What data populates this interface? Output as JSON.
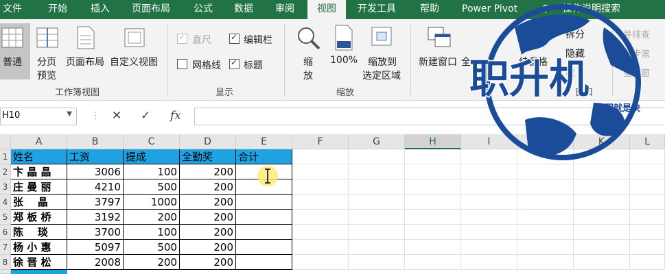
{
  "tabs": [
    "文件",
    "开始",
    "插入",
    "页面布局",
    "公式",
    "数据",
    "审阅",
    "视图",
    "开发工具",
    "帮助",
    "Power Pivot",
    "操作说明搜索"
  ],
  "ribbon": {
    "workbook_views": {
      "normal": "普通",
      "page_break": "分页",
      "page_break2": "预览",
      "page_layout": "页面布局",
      "custom": "自定义视图",
      "group": "工作簿视图"
    },
    "show": {
      "ruler": "直尺",
      "formula_bar": "编辑栏",
      "gridlines": "网格线",
      "headings": "标题",
      "group": "显示"
    },
    "zoom": {
      "zoom1": "缩",
      "zoom2": "放",
      "percent": "100%",
      "zoom_sel1": "缩放到",
      "zoom_sel2": "选定区域",
      "group": "缩放"
    },
    "window": {
      "new_window": "新建窗口",
      "all": "全",
      "freeze": "结窗格",
      "split": "拆分",
      "hide": "隐藏",
      "unhide": "取",
      "group": "窗口",
      "side": "并排查",
      "sync": "同步滚",
      "reset": "重设窗"
    }
  },
  "formula_bar": {
    "name": "H10",
    "cancel": "✕",
    "confirm": "✓",
    "fx": "fx",
    "value": ""
  },
  "columns": [
    "A",
    "B",
    "C",
    "D",
    "E",
    "F",
    "G",
    "H",
    "I",
    "J",
    "K",
    "L"
  ],
  "rows": [
    "1",
    "2",
    "3",
    "4",
    "5",
    "6",
    "7",
    "8"
  ],
  "table": {
    "headers": [
      "姓名",
      "工资",
      "提成",
      "全勤奖",
      "合计"
    ],
    "data": [
      [
        "卞 晶 晶",
        "3006",
        "100",
        "200",
        ""
      ],
      [
        "庄 曼 丽",
        "4210",
        "500",
        "200",
        ""
      ],
      [
        "张    晶",
        "3797",
        "1000",
        "200",
        ""
      ],
      [
        "郑 板 桥",
        "3192",
        "200",
        "200",
        ""
      ],
      [
        "陈    琰",
        "3700",
        "100",
        "200",
        ""
      ],
      [
        "杨 小 惠",
        "5097",
        "500",
        "200",
        ""
      ],
      [
        "徐 晋 松",
        "2008",
        "200",
        "200",
        ""
      ]
    ]
  },
  "watermark": {
    "title": "职升机",
    "slogan": "升职就是快"
  },
  "colors": {
    "ribbon": "#217346",
    "header_fill": "#1fa2e1",
    "watermark": "#1a4c9a"
  }
}
